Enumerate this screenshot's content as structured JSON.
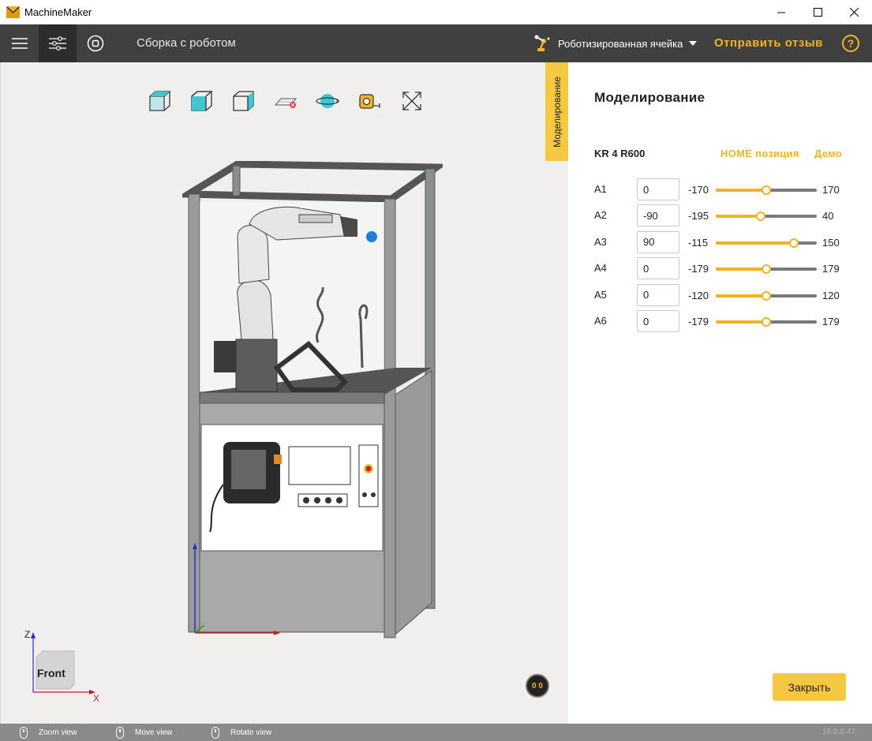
{
  "window": {
    "title": "MachineMaker",
    "minimize_icon": "minimize-icon",
    "maximize_icon": "maximize-icon",
    "close_icon": "close-icon"
  },
  "toolbar": {
    "project_title": "Сборка с роботом",
    "cell_selector": "Роботизированная ячейка",
    "feedback": "Отправить отзыв",
    "help": "?",
    "accent_color": "#f0b323",
    "background_color": "#404040"
  },
  "viewport": {
    "side_tab": "Моделирование",
    "fps_indicator": "0 0",
    "view_cube_label": "Front",
    "axis_x": "X",
    "axis_z": "Z",
    "background_color": "#f0efee"
  },
  "statusbar": {
    "zoom": "Zoom view",
    "move": "Move view",
    "rotate": "Rotate view",
    "version": "18.0.0.47"
  },
  "panel": {
    "title": "Моделирование",
    "robot_model": "KR 4 R600",
    "home_link": "HOME позиция",
    "demo_link": "Демо",
    "axes": [
      {
        "name": "A1",
        "value": "0",
        "min": "-170",
        "max": "170",
        "fraction": 0.5
      },
      {
        "name": "A2",
        "value": "-90",
        "min": "-195",
        "max": "40",
        "fraction": 0.447
      },
      {
        "name": "A3",
        "value": "90",
        "min": "-115",
        "max": "150",
        "fraction": 0.774
      },
      {
        "name": "A4",
        "value": "0",
        "min": "-179",
        "max": "179",
        "fraction": 0.5
      },
      {
        "name": "A5",
        "value": "0",
        "min": "-120",
        "max": "120",
        "fraction": 0.5
      },
      {
        "name": "A6",
        "value": "0",
        "min": "-179",
        "max": "179",
        "fraction": 0.5
      }
    ],
    "close_button": "Закрыть"
  }
}
